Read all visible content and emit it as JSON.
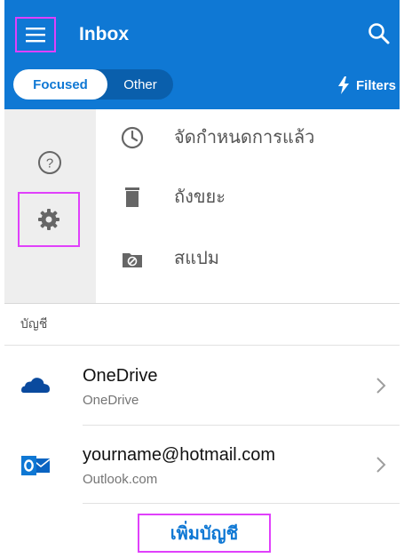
{
  "header": {
    "title": "Inbox",
    "menu_icon": "hamburger-menu-icon",
    "search_icon": "search-icon",
    "tabs": [
      {
        "label": "Focused",
        "selected": true
      },
      {
        "label": "Other",
        "selected": false
      }
    ],
    "filters_label": "Filters",
    "filters_icon": "lightning-icon",
    "accent_color": "#0f78d4"
  },
  "rail": {
    "help_icon": "help-icon",
    "settings_icon": "gear-icon"
  },
  "folders": [
    {
      "label": "จัดกำหนดการแล้ว",
      "icon": "clock-icon"
    },
    {
      "label": "ถังขยะ",
      "icon": "trash-icon"
    },
    {
      "label": "สแปม",
      "icon": "spam-folder-icon"
    }
  ],
  "accounts_section": {
    "label": "บัญชี",
    "accounts": [
      {
        "name": "OneDrive",
        "subtitle": "OneDrive",
        "icon": "onedrive-icon"
      },
      {
        "name": "yourname@hotmail.com",
        "subtitle": "Outlook.com",
        "icon": "outlook-icon"
      }
    ],
    "add_account_label": "เพิ่มบัญชี"
  },
  "highlight_color": "#e040fb"
}
